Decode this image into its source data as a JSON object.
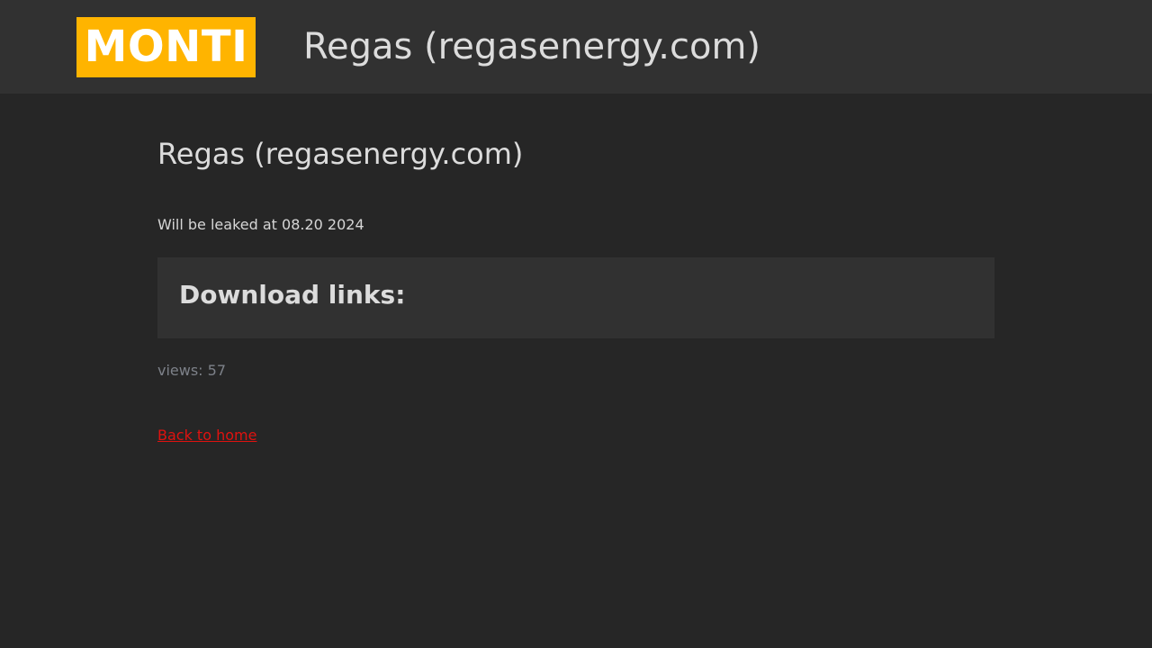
{
  "header": {
    "logo_text": "MONTI",
    "title": "Regas (regasenergy.com)"
  },
  "main": {
    "title": "Regas (regasenergy.com)",
    "leak_notice": "Will be leaked at 08.20 2024",
    "download_heading": "Download links:",
    "views": "views: 57",
    "back_link": "Back to home"
  },
  "colors": {
    "background": "#262626",
    "header_bg": "#313131",
    "logo_bg": "#ffb400",
    "text": "#dcdcdc",
    "muted": "#7d8189",
    "link": "#e0120f"
  }
}
